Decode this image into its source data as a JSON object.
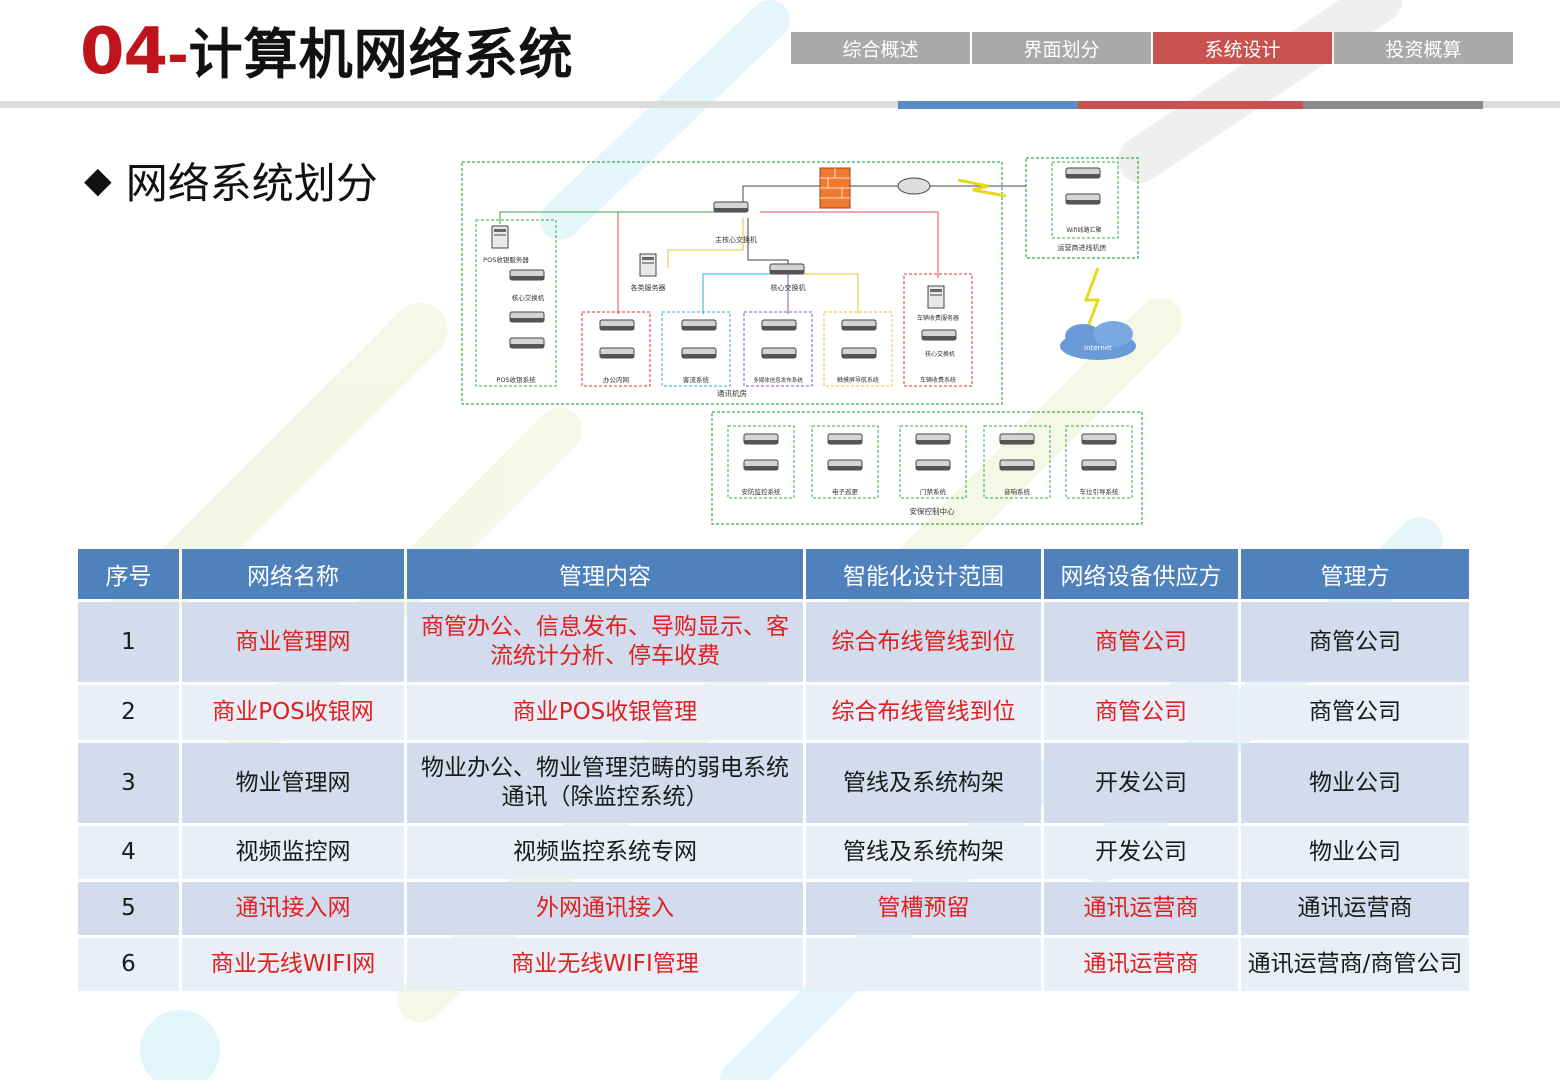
{
  "header": {
    "number": "04",
    "dash": "-",
    "title": "计算机网络系统",
    "tabs": [
      {
        "label": "综合概述",
        "active": false
      },
      {
        "label": "界面划分",
        "active": false
      },
      {
        "label": "系统设计",
        "active": true
      },
      {
        "label": "投资概算",
        "active": false
      }
    ]
  },
  "section": {
    "bullet": "◆",
    "title": "网络系统划分"
  },
  "diagram": {
    "top_group": "通讯机房",
    "bottom_group": "安保控制中心",
    "carrier_room": "运营商进线机房",
    "carrier_wifi": "Wifi线路汇聚",
    "internet": "Internet",
    "main_switch": "主核心交换机",
    "core_switch": "核心交换机",
    "servers": "各类服务器",
    "pos_server": "POS收银服务器",
    "pos_core": "核心交换机",
    "pos_system": "POS收银系统",
    "parking_server": "车辆收费服务器",
    "parking_core": "核心交换机",
    "parking_system": "车辆收费系统",
    "office": "办公内网",
    "traffic": "客流系统",
    "media": "多媒体信息发布系统",
    "guide": "触摸屏导航系统",
    "security": [
      "安防监控系统",
      "电子巡更",
      "门禁系统",
      "音响系统",
      "车位引导系统"
    ]
  },
  "table": {
    "headers": [
      "序号",
      "网络名称",
      "管理内容",
      "智能化设计范围",
      "网络设备供应方",
      "管理方"
    ],
    "rows": [
      {
        "no": "1",
        "name": "商业管理网",
        "content": "商管办公、信息发布、导购显示、客流统计分析、停车收费",
        "scope": "综合布线管线到位",
        "supplier": "商管公司",
        "manager": "商管公司"
      },
      {
        "no": "2",
        "name": "商业POS收银网",
        "content": "商业POS收银管理",
        "scope": "综合布线管线到位",
        "supplier": "商管公司",
        "manager": "商管公司"
      },
      {
        "no": "3",
        "name": "物业管理网",
        "content": "物业办公、物业管理范畴的弱电系统通讯（除监控系统）",
        "scope": "管线及系统构架",
        "supplier": "开发公司",
        "manager": "物业公司"
      },
      {
        "no": "4",
        "name": "视频监控网",
        "content": "视频监控系统专网",
        "scope": "管线及系统构架",
        "supplier": "开发公司",
        "manager": "物业公司"
      },
      {
        "no": "5",
        "name": "通讯接入网",
        "content": "外网通讯接入",
        "scope": "管槽预留",
        "supplier": "通讯运营商",
        "manager": "通讯运营商"
      },
      {
        "no": "6",
        "name": "商业无线WIFI网",
        "content": "商业无线WIFI管理",
        "scope": "",
        "supplier": "通讯运营商",
        "manager": "通讯运营商/商管公司"
      }
    ]
  },
  "colors": {
    "accent_red": "#c0141c",
    "text_red": "#e02020",
    "header_blue": "#4f81bd",
    "tab_gray": "#a9a9a9",
    "tab_active": "#c9524e"
  }
}
